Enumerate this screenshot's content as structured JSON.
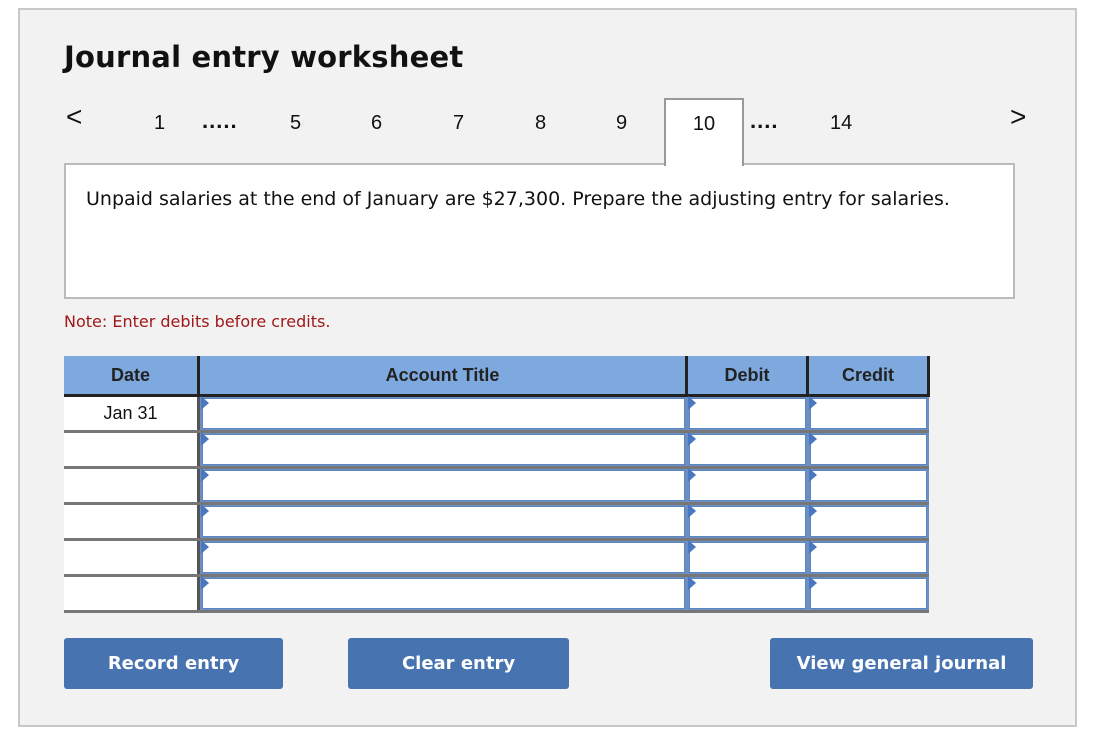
{
  "header": {
    "title": "Journal entry worksheet"
  },
  "pagination": {
    "prev_icon": "chevron-left-icon",
    "next_icon": "chevron-right-icon",
    "prev_glyph": "<",
    "next_glyph": ">",
    "items": [
      {
        "label": "1"
      },
      {
        "label": "....."
      },
      {
        "label": "5"
      },
      {
        "label": "6"
      },
      {
        "label": "7"
      },
      {
        "label": "8"
      },
      {
        "label": "9"
      },
      {
        "label": "10",
        "active": true
      },
      {
        "label": "...."
      },
      {
        "label": "14"
      }
    ]
  },
  "question": {
    "text": "Unpaid salaries at the end of January are $27,300. Prepare the adjusting entry for salaries."
  },
  "note": "Note: Enter debits before credits.",
  "table": {
    "headers": [
      "Date",
      "Account Title",
      "Debit",
      "Credit"
    ],
    "rows": [
      {
        "date": "Jan 31",
        "account": "",
        "debit": "",
        "credit": ""
      },
      {
        "date": "",
        "account": "",
        "debit": "",
        "credit": ""
      },
      {
        "date": "",
        "account": "",
        "debit": "",
        "credit": ""
      },
      {
        "date": "",
        "account": "",
        "debit": "",
        "credit": ""
      },
      {
        "date": "",
        "account": "",
        "debit": "",
        "credit": ""
      },
      {
        "date": "",
        "account": "",
        "debit": "",
        "credit": ""
      }
    ]
  },
  "buttons": {
    "record": "Record entry",
    "clear": "Clear entry",
    "view": "View general journal"
  },
  "colors": {
    "accent_button": "#4774b1",
    "header_blue": "#7ea9de",
    "note_red": "#a01818"
  }
}
